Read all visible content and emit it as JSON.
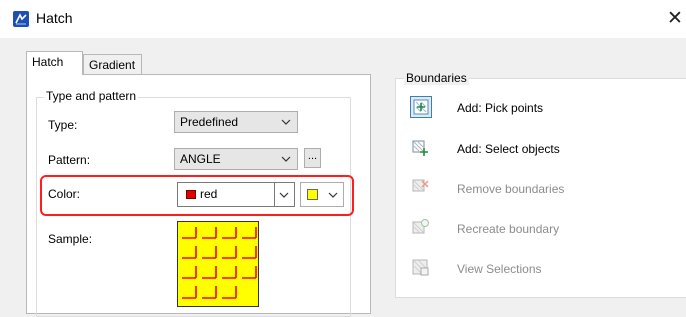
{
  "window": {
    "title": "Hatch",
    "close_glyph": "✕",
    "icon": "hatch-app-icon"
  },
  "tabs": [
    {
      "label": "Hatch",
      "active": true
    },
    {
      "label": "Gradient",
      "active": false
    }
  ],
  "type_pattern": {
    "group_label": "Type and pattern",
    "type_label": "Type:",
    "type_value": "Predefined",
    "pattern_label": "Pattern:",
    "pattern_value": "ANGLE",
    "pattern_browse": "...",
    "color_label": "Color:",
    "color_value": "red",
    "color_swatch": "#e00000",
    "bg_color_swatch": "#ffff00",
    "sample_label": "Sample:",
    "sample_bg": "#ffff00",
    "sample_line_color": "#ff0000"
  },
  "boundaries": {
    "group_label": "Boundaries",
    "items": [
      {
        "label": "Add: Pick points",
        "enabled": true,
        "icon": "pick-points-icon"
      },
      {
        "label": "Add: Select objects",
        "enabled": true,
        "icon": "select-objects-icon"
      },
      {
        "label": "Remove boundaries",
        "enabled": false,
        "icon": "remove-boundaries-icon"
      },
      {
        "label": "Recreate boundary",
        "enabled": false,
        "icon": "recreate-boundary-icon"
      },
      {
        "label": "View Selections",
        "enabled": false,
        "icon": "view-selections-icon"
      }
    ]
  },
  "colors": {
    "highlight": "#ff1e1e",
    "disabled_text": "#8c8c8c"
  }
}
